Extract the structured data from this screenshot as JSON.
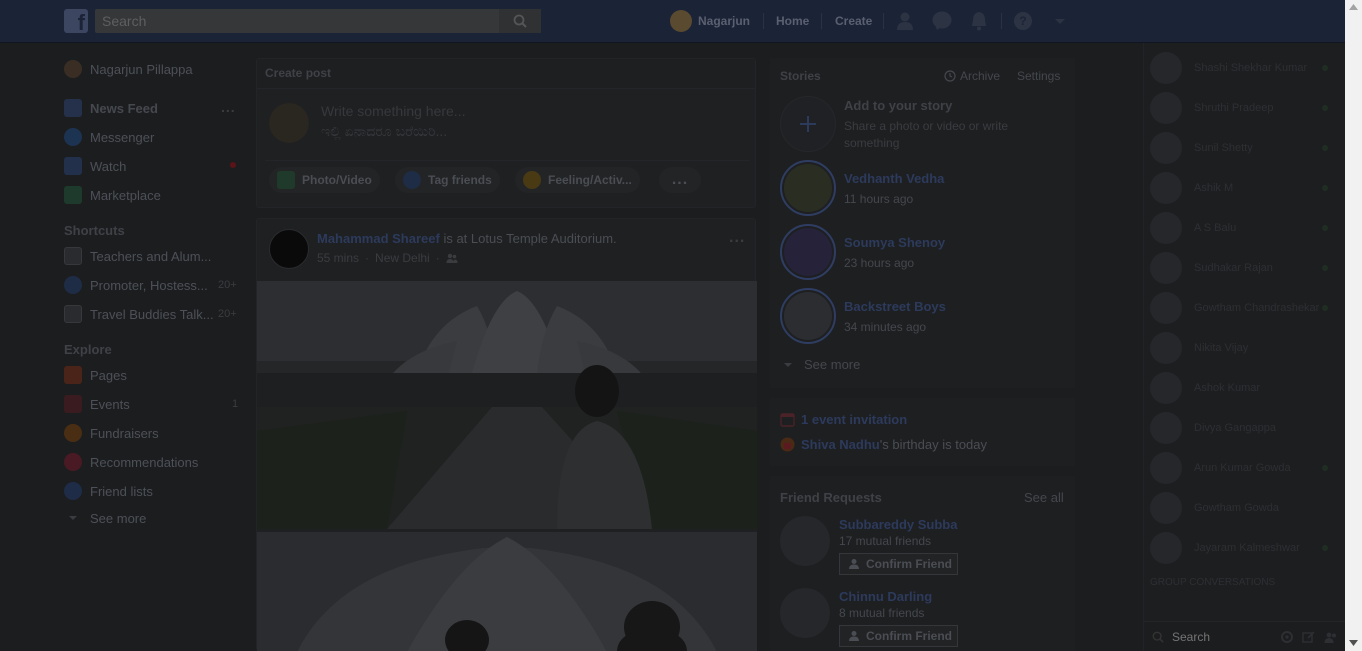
{
  "header": {
    "logo": "f",
    "search_placeholder": "Search",
    "user_name": "Nagarjun",
    "home_label": "Home",
    "create_label": "Create"
  },
  "left_nav": {
    "profile_name": "Nagarjun Pillappa",
    "items": [
      {
        "label": "News Feed",
        "more": "..."
      },
      {
        "label": "Messenger"
      },
      {
        "label": "Watch"
      },
      {
        "label": "Marketplace"
      }
    ],
    "shortcuts_title": "Shortcuts",
    "shortcuts": [
      {
        "label": "Teachers and Alum..."
      },
      {
        "label": "Promoter, Hostess...",
        "count": "20+"
      },
      {
        "label": "Travel Buddies Talk...",
        "count": "20+"
      }
    ],
    "explore_title": "Explore",
    "explore": [
      {
        "label": "Pages"
      },
      {
        "label": "Events",
        "count": "1"
      },
      {
        "label": "Fundraisers"
      },
      {
        "label": "Recommendations"
      },
      {
        "label": "Friend lists"
      }
    ],
    "see_more": "See more"
  },
  "composer": {
    "title": "Create post",
    "placeholder_en": "Write something here...",
    "placeholder_kn": "ಇಲ್ಲಿ ಏನಾದರೂ ಬರೆಯಿರಿ...",
    "actions": [
      "Photo/Video",
      "Tag friends",
      "Feeling/Activ..."
    ],
    "more": "..."
  },
  "post": {
    "author": "Mahammad Shareef",
    "action_text": "is at Lotus Temple Auditorium.",
    "time": "55 mins",
    "location": "New Delhi",
    "more": "..."
  },
  "stories": {
    "title": "Stories",
    "archive": "Archive",
    "settings": "Settings",
    "add_title": "Add to your story",
    "add_sub": "Share a photo or video or write something",
    "items": [
      {
        "name": "Vedhanth Vedha",
        "time": "11 hours ago"
      },
      {
        "name": "Soumya Shenoy",
        "time": "23 hours ago"
      },
      {
        "name": "Backstreet Boys",
        "time": "34 minutes ago"
      }
    ],
    "see_more": "See more"
  },
  "events": {
    "invitation": "1 event invitation",
    "birthday_name": "Shiva Nadhu",
    "birthday_text": "'s birthday is today"
  },
  "friend_requests": {
    "title": "Friend Requests",
    "see_all": "See all",
    "items": [
      {
        "name": "Subbareddy Subba",
        "mutual": "17 mutual friends",
        "button": "Confirm Friend"
      },
      {
        "name": "Chinnu Darling",
        "mutual": "8 mutual friends",
        "button": "Confirm Friend"
      }
    ]
  },
  "chat": {
    "contacts": [
      "Shashi Shekhar Kumar",
      "Shruthi Pradeep",
      "Sunil Shetty",
      "Ashik M",
      "A S Balu",
      "Sudhakar Rajan",
      "Gowtham Chandrashekar",
      "Nikita Vijay",
      "Ashok Kumar",
      "Divya Gangappa",
      "Arun Kumar Gowda",
      "Gowtham Gowda",
      "Jayaram Kalmeshwar"
    ],
    "group_title": "GROUP CONVERSATIONS",
    "search_placeholder": "Search"
  },
  "colors": {
    "topbar": "#1b2336",
    "accent": "#2c3a5c",
    "background": "#1c1d1f"
  }
}
